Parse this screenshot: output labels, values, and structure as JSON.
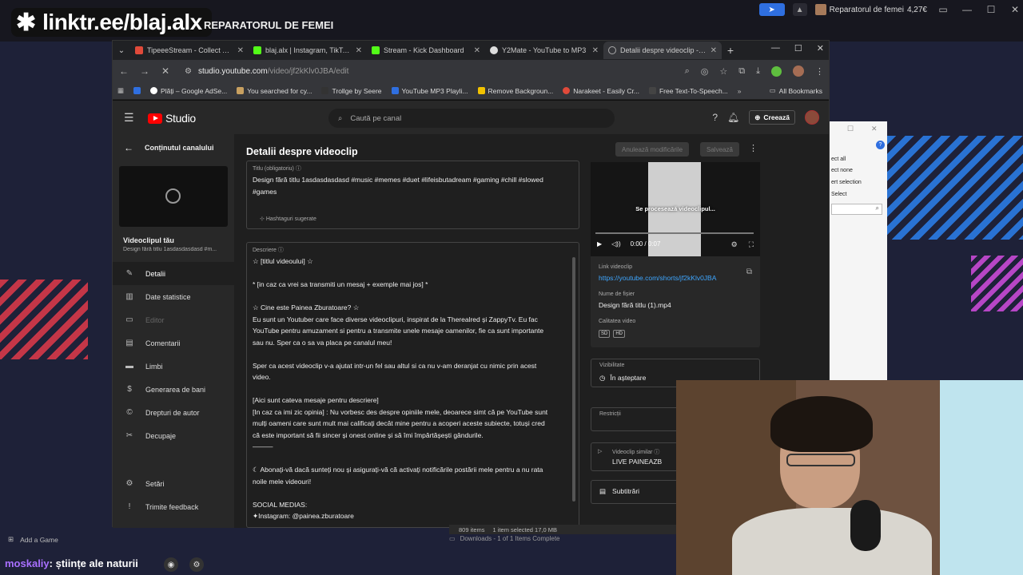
{
  "overlay": {
    "brand": "linktr.ee/blaj.alx",
    "title": "REPARATORUL DE FEMEI",
    "account_name": "Reparatorul de femei",
    "account_balance": "4,27€"
  },
  "browser": {
    "tabs": [
      {
        "title": "TipeeeStream - Collect Tips",
        "color": "#e04a3a"
      },
      {
        "title": "blaj.alx | Instagram, TikTok |",
        "color": "#53fc18"
      },
      {
        "title": "Stream - Kick Dashboard",
        "color": "#53fc18"
      },
      {
        "title": "Y2Mate - YouTube to MP3",
        "color": "#dddddd"
      },
      {
        "title": "Detalii despre videoclip - Yo",
        "color": "#ff0000"
      }
    ],
    "url_host": "studio.youtube.com",
    "url_path": "/video/jf2kKlv0JBA/edit",
    "bookmarks": [
      "Plăți – Google AdSe...",
      "You searched for cy...",
      "Trollge by Seere",
      "YouTube MP3 Playli...",
      "Remove Backgroun...",
      "Narakeet - Easily Cr...",
      "Free Text-To-Speech..."
    ],
    "all_bookmarks": "All Bookmarks"
  },
  "studio": {
    "logo": "Studio",
    "search_placeholder": "Caută pe canal",
    "create_label": "Creează",
    "back_label": "Conținutul canalului",
    "video_label": "Videoclipul tău",
    "video_sub": "Design fără titlu 1asdasdasdasd #m...",
    "nav": [
      {
        "label": "Detalii",
        "icon": "✎"
      },
      {
        "label": "Date statistice",
        "icon": "▥"
      },
      {
        "label": "Editor",
        "icon": "▭"
      },
      {
        "label": "Comentarii",
        "icon": "▤"
      },
      {
        "label": "Limbi",
        "icon": "▬"
      },
      {
        "label": "Generarea de bani",
        "icon": "$"
      },
      {
        "label": "Drepturi de autor",
        "icon": "©"
      },
      {
        "label": "Decupaje",
        "icon": "✂"
      }
    ],
    "nav_bottom": [
      {
        "label": "Setări",
        "icon": "⚙"
      },
      {
        "label": "Trimite feedback",
        "icon": "!"
      }
    ],
    "page_title": "Detalii despre videoclip",
    "undo_label": "Anulează modificările",
    "save_label": "Salvează",
    "title_field_label": "Titlu (obligatoriu)",
    "title_value": "Design fără titlu 1asdasdasdasd #music #memes #duet #lifeisbutadream #gaming #chill #slowed\n#games",
    "hashtag_label": "Hashtaguri sugerate",
    "desc_label": "Descriere",
    "desc_value": "☆ [titlul videoului] ☆\n\n* [in caz ca vrei sa transmiti un mesaj + exemple mai jos] *\n\n☆ Cine este Painea Zburatoare? ☆\nEu sunt un Youtuber care face diverse videoclipuri, inspirat de la Therealred și ZappyTv. Eu fac\nYouTube pentru amuzament si pentru a transmite unele mesaje oamenilor, fie ca sunt importante\nsau nu. Sper ca o sa va placa pe canalul meu!\n\nSper ca acest videoclip v-a ajutat intr-un fel sau altul si ca nu v-am deranjat cu nimic prin acest\nvideo.\n\n[Aici sunt cateva mesaje pentru descriere]\n[In caz ca imi zic opinia] : Nu vorbesc des despre opiniile mele, deoarece simt că pe YouTube sunt\nmulți oameni care sunt mult mai calificați decât mine pentru a acoperi aceste subiecte, totuși cred\ncă este important să fii sincer și onest online și să îmi împărtășești gândurile.\n———\n\n☾ Abonați-vă dacă sunteți nou și asigurați-vă că activați notificările postării mele pentru a nu rata\nnoile mele videouri!\n\nSOCIAL MEDIAS:\n✦Instagram: @painea.zburatoare",
    "preview_processing": "Se procesează videoclipul...",
    "time": "0:00 / 0:07",
    "link_label": "Link videoclip",
    "link": "https://youtube.com/shorts/jf2kKlv0JBA",
    "file_label": "Nume de fișier",
    "file_name": "Design fără titlu (1).mp4",
    "quality_label": "Calitatea video",
    "quality_badges": [
      "SD",
      "HD"
    ],
    "visibility_label": "Vizibilitate",
    "visibility_value": "În așteptare",
    "restrictions_label": "Restricții",
    "similar_label": "Videoclip similar",
    "similar_value": "LIVE PAINEAZB",
    "subtitles_label": "Subtitrări"
  },
  "explorer": {
    "items": [
      "ect all",
      "ect none",
      "ert selection",
      "Select"
    ]
  },
  "status": {
    "items": "809 items",
    "selected": "1 item selected  17,0 MB",
    "downloads": "Downloads - 1 of 1 Items Complete"
  },
  "bottom": {
    "add_game": "Add a Game",
    "chat_user": "moskaliy",
    "chat_msg": ": științe ale naturii"
  }
}
